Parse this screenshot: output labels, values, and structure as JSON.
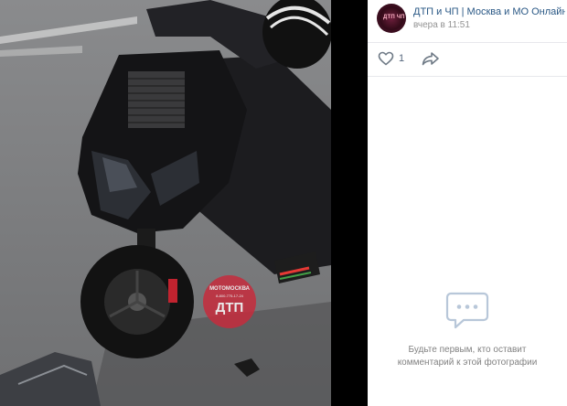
{
  "post": {
    "community_name": "ДТП и ЧП | Москва и МО Онлайн | ...",
    "time": "вчера в 11:51",
    "avatar_text": "ДТП ЧП"
  },
  "actions": {
    "likes": "1",
    "like_icon": "heart-icon",
    "share_icon": "share-arrow-icon"
  },
  "comments": {
    "empty_line1": "Будьте первым, кто оставит",
    "empty_line2": "комментарий к этой фотографии"
  },
  "photo": {
    "watermark_top": "МОТОМОСКВА",
    "watermark_phone": "8-800-775-17-24",
    "watermark_main": "ДТП"
  },
  "colors": {
    "link": "#2a5885",
    "muted": "#939393",
    "watermark": "#c62c3d"
  }
}
